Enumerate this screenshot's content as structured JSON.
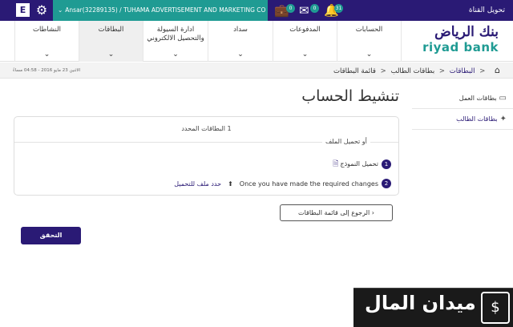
{
  "topbar": {
    "e_label": "E",
    "account_text": "Ansar(32289135) / TUHAMA ADVERTISEMENT AND MARKETING CO",
    "briefcase_count": "0",
    "mail_count": "0",
    "bell_count": "31",
    "switch_channel": "تحويل القناة"
  },
  "logo": {
    "arabic": "بنك الرياض",
    "english": "riyad bank"
  },
  "nav": {
    "accounts": "الحسابات",
    "payments": "المدفوعات",
    "sadad": "سداد",
    "liquidity_line1": "ادارة السيولة",
    "liquidity_line2": "والتحصيل الالكتروني",
    "cards": "البطاقات",
    "activities": "النشاطات"
  },
  "breadcrumb": {
    "date": "الاثنين 23 مايو 2016 - 04:58 مساءً",
    "cards": "البطاقات",
    "student_cards": "بطاقات الطالب",
    "cards_list": "قائمة البطاقات"
  },
  "side": {
    "work_cards": "بطاقات العمل",
    "student_cards": "بطاقات الطالب"
  },
  "main": {
    "title": "تنشيط الحساب",
    "selected_cards": "1 البطاقات المحدد",
    "or_upload": "أو تحميل الملف",
    "step1_num": "1",
    "step1_text": "تحميل النموذج",
    "step2_num": "2",
    "step2_text": "Once you have made the required changes",
    "step2_link": "حدد ملف للتحميل",
    "back_button": "الرجوع إلى قائمة البطاقات",
    "verify_button": "التحقق"
  },
  "watermark": {
    "text": "ميدان المال"
  }
}
